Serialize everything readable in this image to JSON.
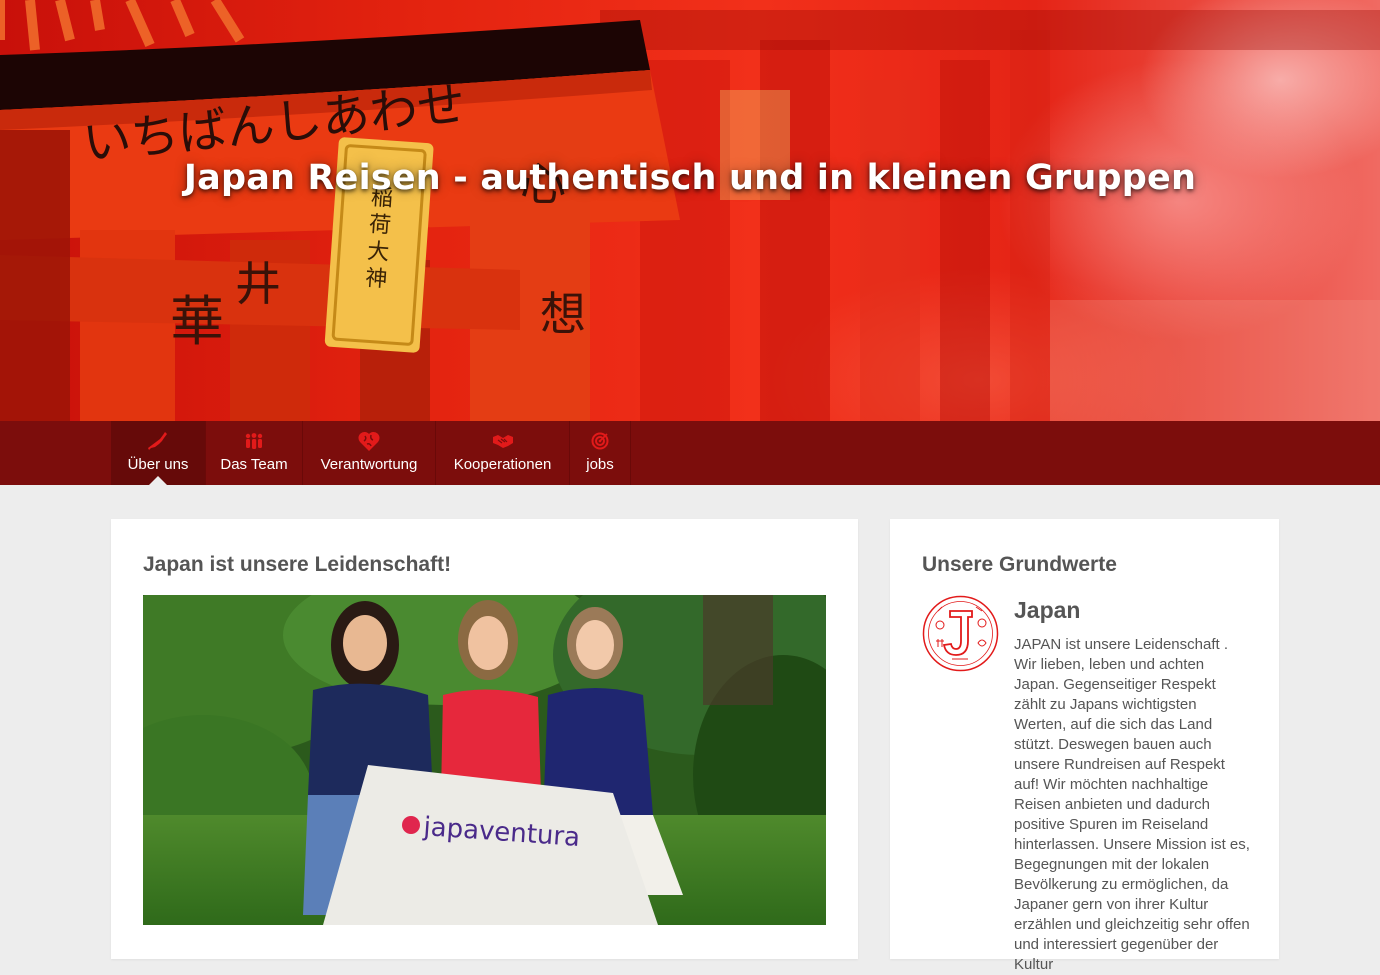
{
  "hero": {
    "title": "Japan Reisen - authentisch und in kleinen Gruppen",
    "sign_text_top": "いちばんしあわせ",
    "sign_text_plaque": "稲荷大神"
  },
  "nav": {
    "items": [
      {
        "label": "Über uns",
        "icon": "japan-map-icon",
        "active": true
      },
      {
        "label": "Das Team",
        "icon": "team-icon",
        "active": false
      },
      {
        "label": "Verantwortung",
        "icon": "heart-globe-icon",
        "active": false
      },
      {
        "label": "Kooperationen",
        "icon": "handshake-icon",
        "active": false
      },
      {
        "label": "jobs",
        "icon": "target-icon",
        "active": false
      }
    ]
  },
  "main": {
    "title": "Japan ist unsere Leidenschaft!",
    "photo_banner_text": "japaventura"
  },
  "sidebar": {
    "title": "Unsere Grundwerte",
    "value": {
      "icon": "japan-j-emblem-icon",
      "title": "Japan",
      "text": "JAPAN ist unsere Leidenschaft . Wir lieben, leben und achten Japan. Gegenseitiger Respekt zählt zu Japans wichtigsten Werten, auf die sich das Land stützt. Deswegen bauen auch unsere Rundreisen auf Respekt auf! Wir möchten nachhaltige Reisen anbieten und dadurch positive Spuren im Reiseland hinterlassen. Unsere Mission ist es, Begegnungen mit der lokalen Bevölkerung zu ermöglichen, da Japaner gern von ihrer Kultur erzählen und gleichzeitig sehr offen und interessiert gegenüber der Kultur"
    }
  },
  "colors": {
    "nav_bg": "#7c0d0c",
    "nav_active_bg": "#660a09",
    "accent_red": "#e21a1a",
    "page_bg": "#ededed"
  }
}
